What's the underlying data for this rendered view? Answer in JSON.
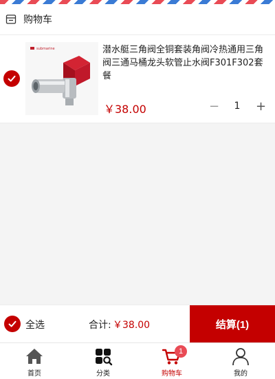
{
  "header": {
    "title": "购物车",
    "icon": "store-icon"
  },
  "cart_items": [
    {
      "title": "潜水艇三角阀全铜套装角阀冷热通用三角阀三通马桶龙头软管止水阀F301F302套餐",
      "price": "￥38.00",
      "quantity": "1",
      "decrement_label": "−",
      "increment_label": "+",
      "checked": true,
      "image_brand_text": "submarine"
    }
  ],
  "footer": {
    "select_all_label": "全选",
    "total_label": "合计:",
    "total_value": "￥38.00",
    "checkout_label": "结算(1)"
  },
  "tabs": [
    {
      "label": "首页",
      "icon": "home-icon"
    },
    {
      "label": "分类",
      "icon": "category-icon"
    },
    {
      "label": "购物车",
      "icon": "cart-icon",
      "badge": "1",
      "active": true
    },
    {
      "label": "我的",
      "icon": "user-icon"
    }
  ],
  "colors": {
    "accent": "#c40000",
    "badge": "#e94b55",
    "background": "#f4f4f4"
  }
}
